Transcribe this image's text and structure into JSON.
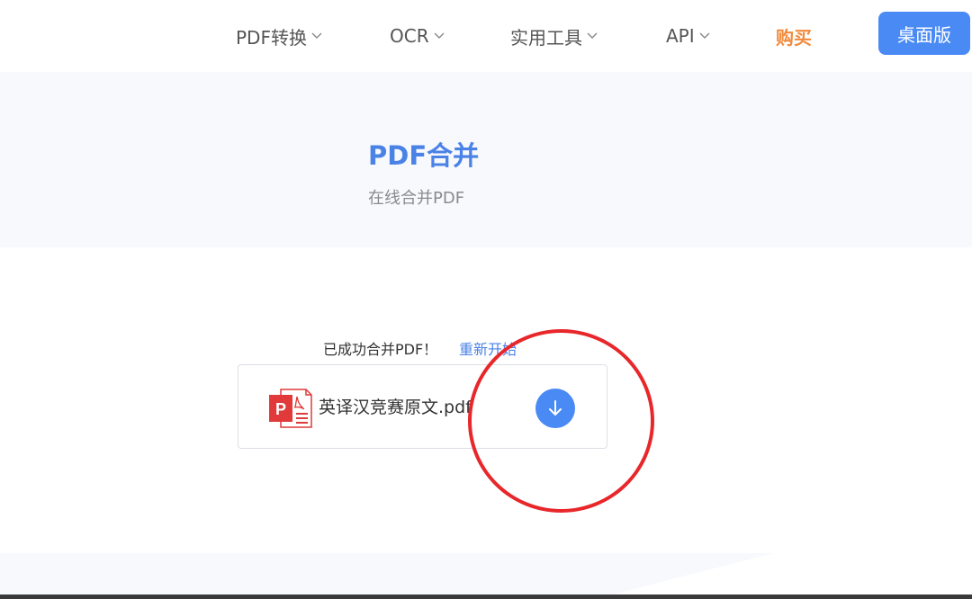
{
  "nav": {
    "items": [
      {
        "label": "PDF转换",
        "icon": "chevron-down-icon"
      },
      {
        "label": "OCR",
        "icon": "chevron-down-icon"
      },
      {
        "label": "实用工具",
        "icon": "chevron-down-icon"
      },
      {
        "label": "API",
        "icon": "chevron-down-icon"
      }
    ],
    "buy_label": "购买",
    "desktop_button": "桌面版"
  },
  "hero": {
    "title": "PDF合并",
    "subtitle": "在线合并PDF"
  },
  "result": {
    "status_text": "已成功合并PDF！",
    "restart_label": "重新开始",
    "file": {
      "name": "英译汉竞赛原文.pdf",
      "icon": "pdf-file-icon"
    },
    "download_icon": "download-arrow-icon"
  },
  "colors": {
    "accent": "#4a8af4",
    "title_blue": "#4a82e6",
    "buy_orange": "#f28a3c",
    "annotation_red": "#e8272b",
    "pdf_red": "#e03a3a",
    "hero_bg": "#f7f9fd"
  }
}
